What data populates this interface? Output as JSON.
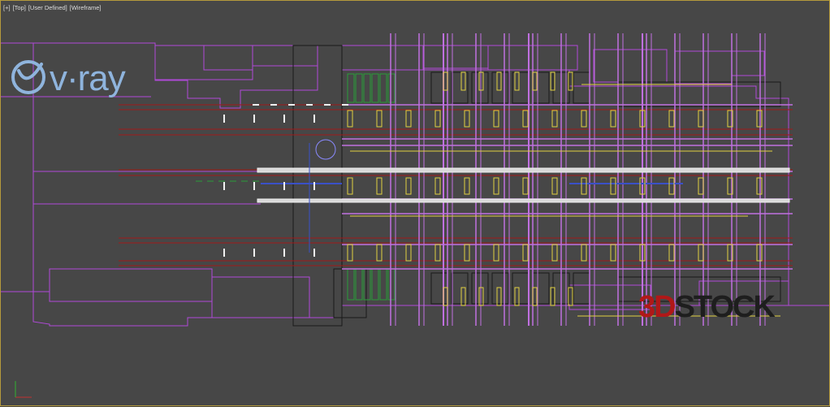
{
  "viewport": {
    "label_plus": "[+]",
    "label_view": "[Top]",
    "label_shading": "[User Defined]",
    "label_mode": "[Wireframe]",
    "border_color": "#b49a3c",
    "background_color": "#474747"
  },
  "logo": {
    "text": "v·ray",
    "icon": "vray-swoosh-icon",
    "color": "#8fb4dd"
  },
  "watermark": {
    "part1": "3D",
    "part2": "STOCK",
    "color1": "#b01818",
    "color2": "#1e1e1e"
  },
  "scene": {
    "description_colors": {
      "outline": "#b04ad8",
      "structure": "#c070e0",
      "walls": "#1a1a1a",
      "fixtures": "#e0d040",
      "red_lines": "#a01818",
      "green": "#2a9c3a",
      "blue": "#3a50c8",
      "white": "#f0f0f0"
    }
  }
}
